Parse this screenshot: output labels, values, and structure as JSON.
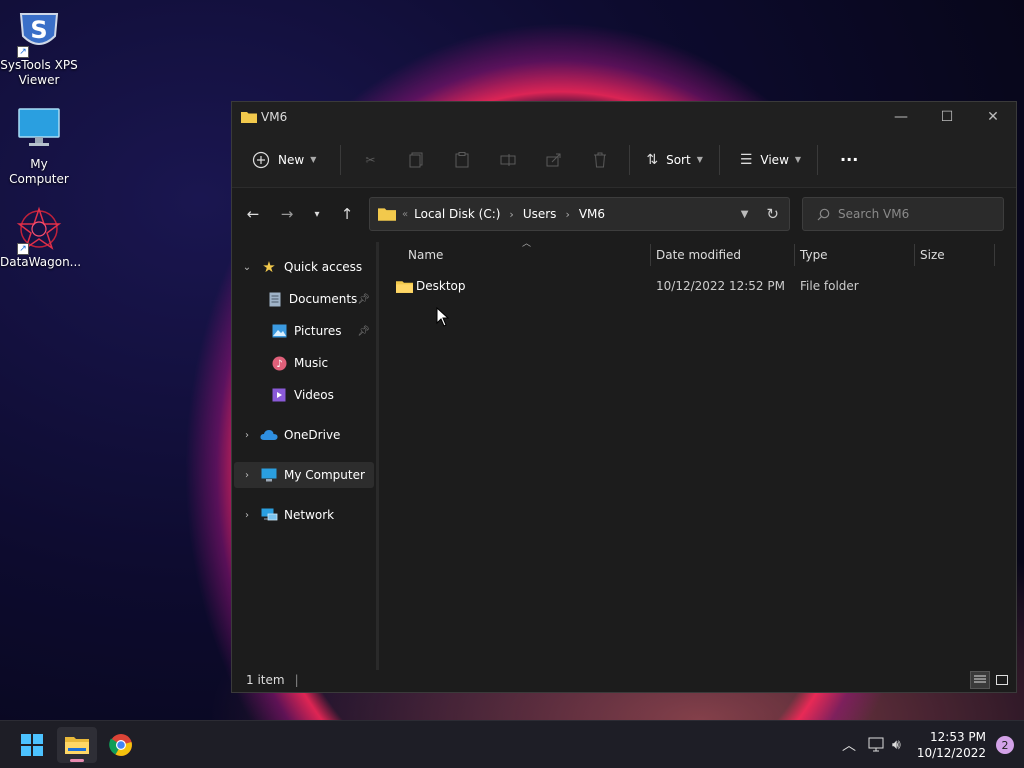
{
  "desktop": {
    "icons": [
      {
        "label": "SysTools XPS Viewer",
        "logo_text": "S"
      },
      {
        "label": "My Computer"
      },
      {
        "label": "DataWagon..."
      }
    ]
  },
  "window": {
    "title": "VM6",
    "toolbar": {
      "new_label": "New",
      "sort_label": "Sort",
      "view_label": "View",
      "more_label": "···"
    },
    "address": {
      "overflow": "«",
      "crumbs": [
        "Local Disk (C:)",
        "Users",
        "VM6"
      ]
    },
    "search": {
      "placeholder": "Search VM6"
    },
    "nav": {
      "quick_access": "Quick access",
      "documents": "Documents",
      "pictures": "Pictures",
      "music": "Music",
      "videos": "Videos",
      "onedrive": "OneDrive",
      "my_computer": "My Computer",
      "network": "Network"
    },
    "columns": {
      "name": "Name",
      "date": "Date modified",
      "type": "Type",
      "size": "Size"
    },
    "files": [
      {
        "name": "Desktop",
        "date": "10/12/2022 12:52 PM",
        "type": "File folder",
        "size": ""
      }
    ],
    "status": {
      "count": "1 item"
    }
  },
  "taskbar": {
    "time": "12:53 PM",
    "date": "10/12/2022",
    "notifications": "2"
  },
  "colors": {
    "folder": "#f2c94c",
    "accent": "#4cc2ff"
  }
}
